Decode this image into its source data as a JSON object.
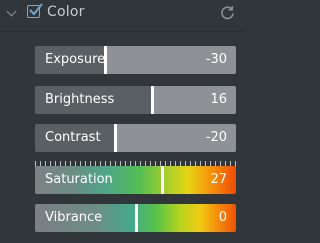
{
  "panel": {
    "title": "Color",
    "enabled": true,
    "icons": {
      "collapse": "chevron-down-icon",
      "checkbox": "checkbox-checked-icon",
      "reset": "refresh-icon"
    }
  },
  "sliders": [
    {
      "label": "Exposure",
      "value": "-30",
      "level": 0.35
    },
    {
      "label": "Brightness",
      "value": "16",
      "level": 0.58
    },
    {
      "label": "Contrast",
      "value": "-20",
      "level": 0.4
    },
    {
      "label": "Saturation",
      "value": "27",
      "level": 0.63
    },
    {
      "label": "Vibrance",
      "value": "0",
      "level": 0.5
    }
  ],
  "colors": {
    "background": "#31363b",
    "slider_fill": "#5a5f64",
    "slider_track": "#8e9296",
    "handle": "#ffffff"
  }
}
